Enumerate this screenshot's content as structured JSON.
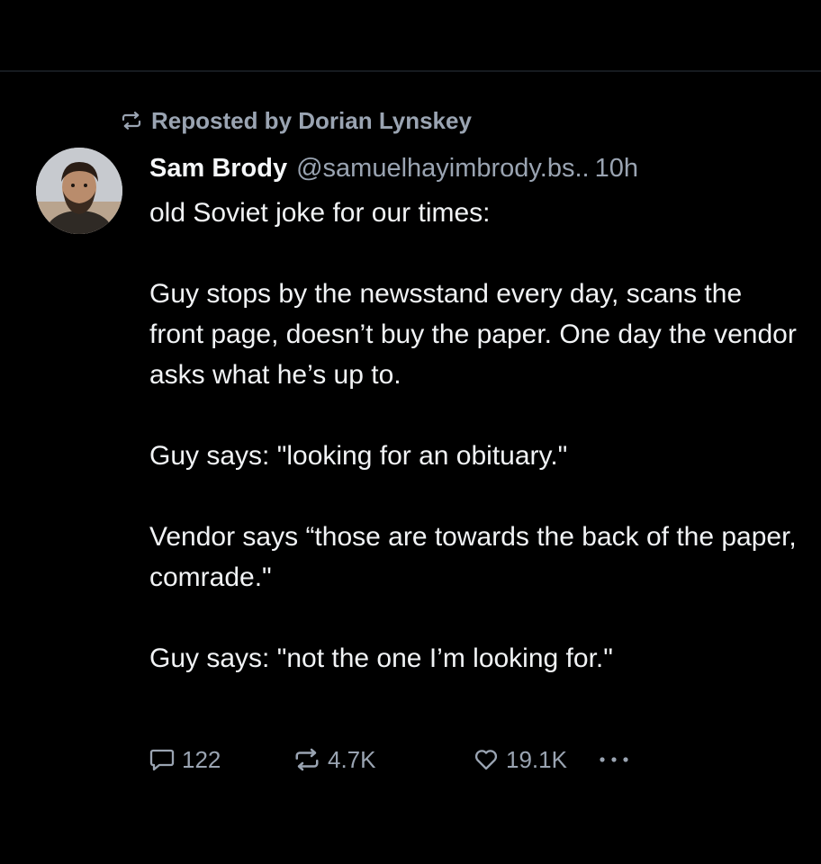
{
  "repost": {
    "icon": "repost-icon",
    "label": "Reposted by Dorian Lynskey"
  },
  "post": {
    "author_name": "Sam Brody",
    "author_handle": "@samuelhayimbrody.bs..",
    "time": "10h",
    "avatar": "avatar-photo",
    "paragraphs": [
      "old Soviet joke for our times:",
      "Guy stops by the newsstand every day, scans the front page, doesn’t buy the paper. One day the vendor asks what he’s up to.",
      "Guy says: \"looking for an obituary.\"",
      "Vendor says “those are towards the back of the paper, comrade.\"",
      "Guy says: \"not the one I’m looking for.\""
    ]
  },
  "actions": {
    "reply_count": "122",
    "repost_count": "4.7K",
    "like_count": "19.1K",
    "reply_icon": "reply-icon",
    "repost_icon": "repost-icon",
    "like_icon": "heart-icon",
    "more_icon": "more-icon"
  },
  "colors": {
    "background": "#000000",
    "text_primary": "#f1f3f5",
    "text_secondary": "#9aa4b2"
  }
}
